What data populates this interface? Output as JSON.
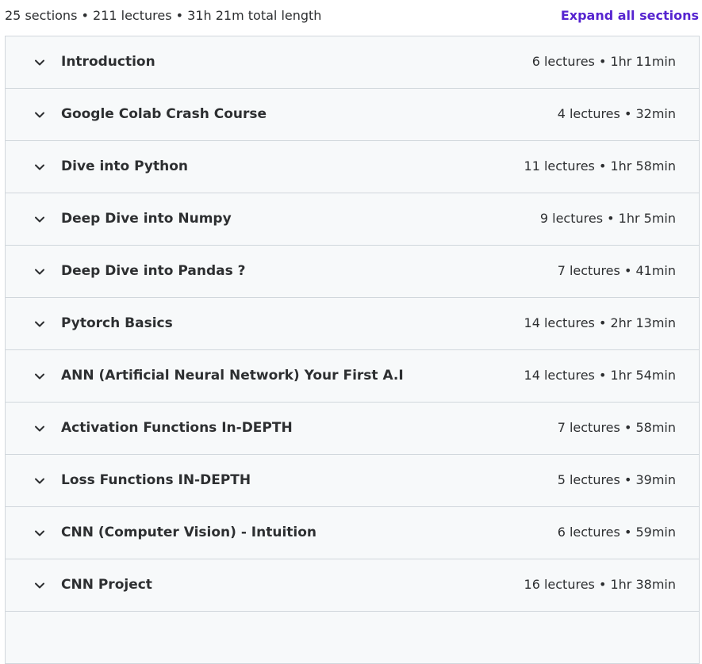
{
  "summary": {
    "text": "25 sections • 211 lectures • 31h 21m total length",
    "expand_label": "Expand all sections"
  },
  "colors": {
    "accent": "#5624d0",
    "row_background": "#f7f9fa",
    "border": "#d1d7dc",
    "text": "#2d2f31"
  },
  "sections": [
    {
      "title": "Introduction",
      "meta": "6 lectures • 1hr 11min",
      "icon": "chevron-down-icon"
    },
    {
      "title": "Google Colab Crash Course",
      "meta": "4 lectures • 32min",
      "icon": "chevron-down-icon"
    },
    {
      "title": "Dive into Python",
      "meta": "11 lectures • 1hr 58min",
      "icon": "chevron-down-icon"
    },
    {
      "title": "Deep Dive into Numpy",
      "meta": "9 lectures • 1hr 5min",
      "icon": "chevron-down-icon"
    },
    {
      "title": "Deep Dive into Pandas ?",
      "meta": "7 lectures • 41min",
      "icon": "chevron-down-icon"
    },
    {
      "title": "Pytorch Basics",
      "meta": "14 lectures • 2hr 13min",
      "icon": "chevron-down-icon"
    },
    {
      "title": "ANN (Artificial Neural Network) Your First A.I",
      "meta": "14 lectures • 1hr 54min",
      "icon": "chevron-down-icon"
    },
    {
      "title": "Activation Functions In-DEPTH",
      "meta": "7 lectures • 58min",
      "icon": "chevron-down-icon"
    },
    {
      "title": "Loss Functions IN-DEPTH",
      "meta": "5 lectures • 39min",
      "icon": "chevron-down-icon"
    },
    {
      "title": "CNN (Computer Vision) - Intuition",
      "meta": "6 lectures • 59min",
      "icon": "chevron-down-icon"
    },
    {
      "title": "CNN Project",
      "meta": "16 lectures • 1hr 38min",
      "icon": "chevron-down-icon"
    },
    {
      "title": "",
      "meta": "",
      "icon": ""
    }
  ]
}
